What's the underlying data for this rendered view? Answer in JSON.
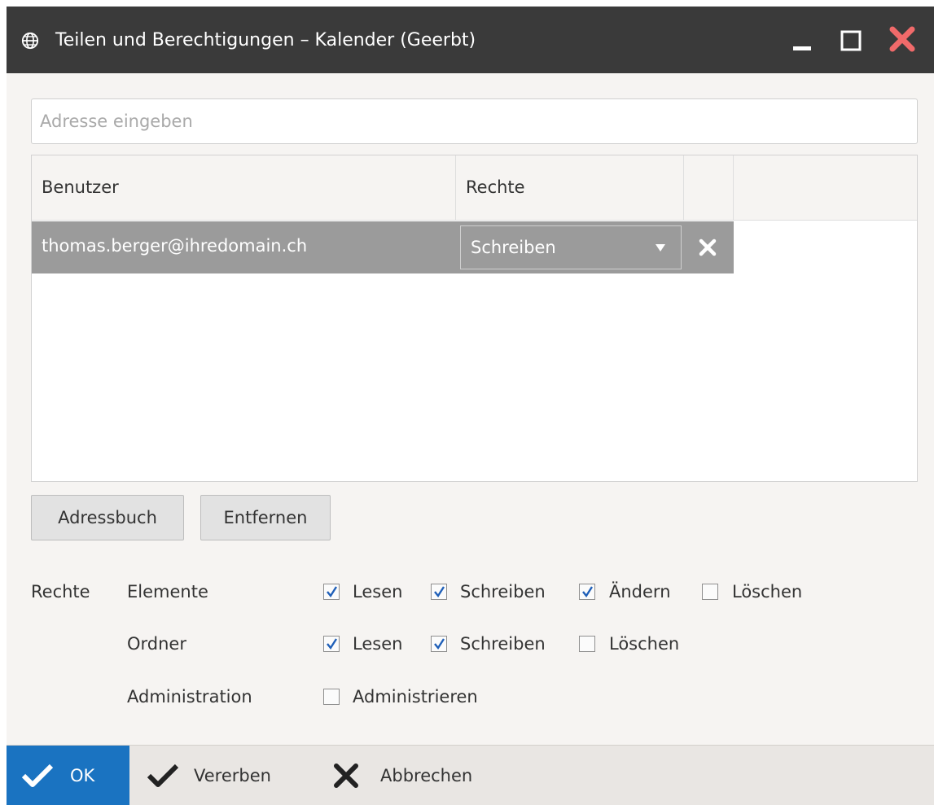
{
  "window": {
    "title": "Teilen und Berechtigungen – Kalender (Geerbt)",
    "icons": {
      "app": "globe-icon",
      "minimize": "minimize-icon",
      "maximize": "maximize-icon",
      "close": "close-icon"
    },
    "close_color": "#f06a6a"
  },
  "address": {
    "placeholder": "Adresse eingeben",
    "value": ""
  },
  "grid": {
    "columns": [
      "Benutzer",
      "Rechte"
    ],
    "rows": [
      {
        "user": "thomas.berger@ihredomain.ch",
        "rights": "Schreiben",
        "selected": true
      }
    ]
  },
  "buttons": {
    "address_book": "Adressbuch",
    "remove": "Entfernen"
  },
  "rights": {
    "label": "Rechte",
    "groups": [
      {
        "label": "Elemente",
        "options": [
          {
            "label": "Lesen",
            "checked": true
          },
          {
            "label": "Schreiben",
            "checked": true
          },
          {
            "label": "Ändern",
            "checked": true
          },
          {
            "label": "Löschen",
            "checked": false
          }
        ]
      },
      {
        "label": "Ordner",
        "options": [
          {
            "label": "Lesen",
            "checked": true
          },
          {
            "label": "Schreiben",
            "checked": true
          },
          {
            "label": "Löschen",
            "checked": false
          }
        ]
      },
      {
        "label": "Administration",
        "options": [
          {
            "label": "Administrieren",
            "checked": false
          }
        ]
      }
    ]
  },
  "footer": {
    "ok": "OK",
    "inherit": "Vererben",
    "cancel": "Abbrechen"
  },
  "colors": {
    "accent": "#1a73c1",
    "titlebar": "#3a3a3a",
    "selected_row": "#9b9b9b",
    "check": "#1f5fb8"
  }
}
